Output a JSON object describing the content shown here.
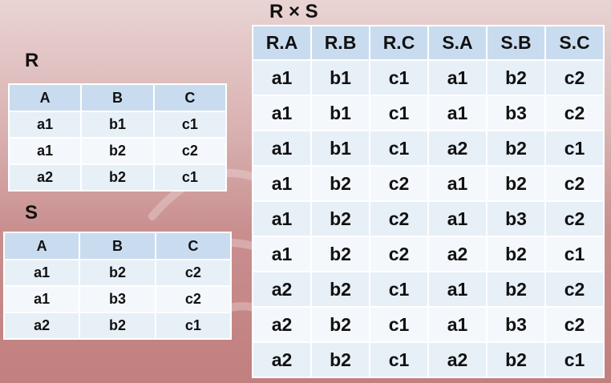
{
  "r": {
    "title": "R",
    "headers": [
      "A",
      "B",
      "C"
    ],
    "rows": [
      [
        "a1",
        "b1",
        "c1"
      ],
      [
        "a1",
        "b2",
        "c2"
      ],
      [
        "a2",
        "b2",
        "c1"
      ]
    ]
  },
  "s": {
    "title": "S",
    "headers": [
      "A",
      "B",
      "C"
    ],
    "rows": [
      [
        "a1",
        "b2",
        "c2"
      ],
      [
        "a1",
        "b3",
        "c2"
      ],
      [
        "a2",
        "b2",
        "c1"
      ]
    ]
  },
  "rs": {
    "title": "R × S",
    "headers": [
      "R.A",
      "R.B",
      "R.C",
      "S.A",
      "S.B",
      "S.C"
    ],
    "rows": [
      [
        "a1",
        "b1",
        "c1",
        "a1",
        "b2",
        "c2"
      ],
      [
        "a1",
        "b1",
        "c1",
        "a1",
        "b3",
        "c2"
      ],
      [
        "a1",
        "b1",
        "c1",
        "a2",
        "b2",
        "c1"
      ],
      [
        "a1",
        "b2",
        "c2",
        "a1",
        "b2",
        "c2"
      ],
      [
        "a1",
        "b2",
        "c2",
        "a1",
        "b3",
        "c2"
      ],
      [
        "a1",
        "b2",
        "c2",
        "a2",
        "b2",
        "c1"
      ],
      [
        "a2",
        "b2",
        "c1",
        "a1",
        "b2",
        "c2"
      ],
      [
        "a2",
        "b2",
        "c1",
        "a1",
        "b3",
        "c2"
      ],
      [
        "a2",
        "b2",
        "c1",
        "a2",
        "b2",
        "c1"
      ]
    ]
  }
}
